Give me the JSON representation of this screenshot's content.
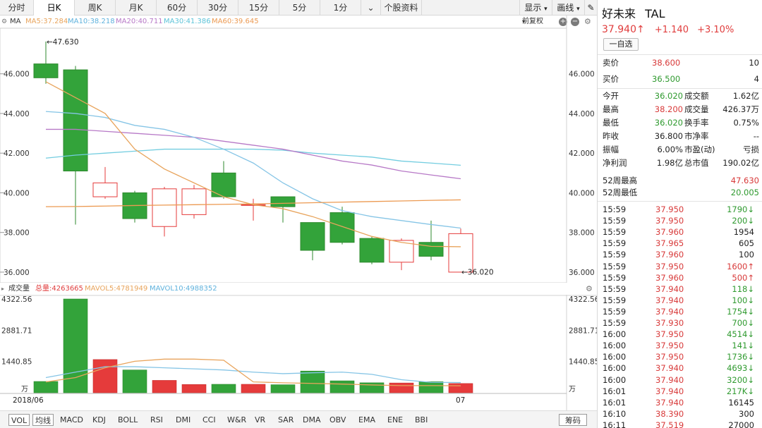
{
  "tabs": [
    {
      "label": "分时",
      "active": false
    },
    {
      "label": "日K",
      "active": true
    },
    {
      "label": "周K",
      "active": false
    },
    {
      "label": "月K",
      "active": false
    },
    {
      "label": "60分",
      "active": false
    },
    {
      "label": "30分",
      "active": false
    },
    {
      "label": "15分",
      "active": false
    },
    {
      "label": "5分",
      "active": false
    },
    {
      "label": "1分",
      "active": false
    }
  ],
  "tab_more": "⌄",
  "tab_info": "个股资料",
  "toolbar": {
    "display": "显示",
    "draw": "画线"
  },
  "ma_legend": {
    "ma": "MA",
    "ma5": "MA5:37.284",
    "ma10": "MA10:38.218",
    "ma20": "MA20:40.711",
    "ma30": "MA30:41.386",
    "ma60": "MA60:39.645",
    "adjust": "前复权"
  },
  "vol_legend": {
    "title": "成交量",
    "total": "总量:4263665",
    "mavol5": "MAVOL5:4781949",
    "mavol10": "MAVOL10:4988352"
  },
  "colors": {
    "up": "#e53b3b",
    "down": "#33a33a",
    "ma5": "#e8a45c",
    "ma10": "#86c5e6",
    "ma20": "#b779c7",
    "ma30": "#73cde0",
    "ma60": "#ec9a52"
  },
  "chart_data": {
    "type": "candlestick",
    "price_axis": {
      "ylim": [
        35.5,
        48.3
      ],
      "ticks": [
        "46.000",
        "44.000",
        "42.000",
        "40.000",
        "38.000",
        "36.000"
      ]
    },
    "max_label": "47.630",
    "min_label": "36.020",
    "candles": [
      {
        "open": 46.5,
        "close": 45.8,
        "high": 47.63,
        "low": 45.5
      },
      {
        "open": 46.2,
        "close": 41.1,
        "high": 46.4,
        "low": 38.4
      },
      {
        "open": 39.8,
        "close": 40.5,
        "high": 41.3,
        "low": 39.7
      },
      {
        "open": 40.0,
        "close": 38.7,
        "high": 40.1,
        "low": 38.5
      },
      {
        "open": 38.3,
        "close": 40.2,
        "high": 40.3,
        "low": 37.8
      },
      {
        "open": 38.9,
        "close": 40.2,
        "high": 40.4,
        "low": 38.7
      },
      {
        "open": 41.0,
        "close": 39.8,
        "high": 41.6,
        "low": 39.7
      },
      {
        "open": 39.4,
        "close": 39.4,
        "high": 39.7,
        "low": 38.6
      },
      {
        "open": 39.8,
        "close": 39.3,
        "high": 39.8,
        "low": 38.5
      },
      {
        "open": 38.5,
        "close": 37.1,
        "high": 38.5,
        "low": 36.6
      },
      {
        "open": 39.0,
        "close": 37.5,
        "high": 39.3,
        "low": 37.4
      },
      {
        "open": 37.7,
        "close": 36.5,
        "high": 37.8,
        "low": 36.4
      },
      {
        "open": 36.5,
        "close": 37.6,
        "high": 37.7,
        "low": 36.1
      },
      {
        "open": 37.5,
        "close": 36.8,
        "high": 38.6,
        "low": 36.6
      },
      {
        "open": 36.0,
        "close": 37.94,
        "high": 38.2,
        "low": 36.02
      }
    ],
    "ma_lines": {
      "ma5": [
        45.6,
        44.8,
        44.0,
        42.2,
        41.2,
        40.5,
        39.8,
        39.4,
        39.2,
        38.8,
        38.3,
        37.8,
        37.5,
        37.3,
        37.28
      ],
      "ma10": [
        44.1,
        44.0,
        43.8,
        43.4,
        43.2,
        42.8,
        42.2,
        41.5,
        40.5,
        39.7,
        39.1,
        38.8,
        38.6,
        38.4,
        38.22
      ],
      "ma20": [
        43.2,
        43.2,
        43.1,
        43.0,
        42.9,
        42.8,
        42.6,
        42.4,
        42.2,
        41.9,
        41.6,
        41.4,
        41.1,
        40.9,
        40.71
      ],
      "ma30": [
        41.75,
        41.9,
        42.0,
        42.1,
        42.2,
        42.2,
        42.2,
        42.2,
        42.15,
        42.0,
        41.9,
        41.8,
        41.6,
        41.5,
        41.39
      ],
      "ma60": [
        39.3,
        39.31,
        39.33,
        39.36,
        39.38,
        39.4,
        39.42,
        39.44,
        39.47,
        39.5,
        39.53,
        39.56,
        39.59,
        39.62,
        39.645
      ]
    },
    "volume_axis": {
      "ylim": [
        0,
        4322.56
      ],
      "ticks": [
        "4322.56",
        "2881.71",
        "1440.85"
      ],
      "unit": "万"
    },
    "volumes": [
      520,
      4322.56,
      1530,
      1050,
      570,
      380,
      390,
      390,
      370,
      1000,
      550,
      460,
      450,
      510,
      426
    ],
    "mavol5": [
      500,
      700,
      1150,
      1450,
      1550,
      1550,
      1500,
      500,
      460,
      430,
      400,
      360,
      330,
      330,
      320
    ],
    "mavol10": [
      700,
      950,
      1200,
      1200,
      1150,
      1100,
      1050,
      950,
      880,
      920,
      950,
      850,
      600,
      480,
      470
    ],
    "x_labels": [
      "2018/06",
      "07"
    ]
  },
  "indicators": [
    {
      "label": "VOL",
      "boxed": true
    },
    {
      "label": "均线",
      "boxed": true
    },
    {
      "label": "MACD",
      "boxed": false
    },
    {
      "label": "KDJ",
      "boxed": false
    },
    {
      "label": "BOLL",
      "boxed": false
    },
    {
      "label": "RSI",
      "boxed": false
    },
    {
      "label": "DMI",
      "boxed": false
    },
    {
      "label": "CCI",
      "boxed": false
    },
    {
      "label": "W&R",
      "boxed": false
    },
    {
      "label": "VR",
      "boxed": false
    },
    {
      "label": "SAR",
      "boxed": false
    },
    {
      "label": "DMA",
      "boxed": false
    },
    {
      "label": "OBV",
      "boxed": false
    },
    {
      "label": "EMA",
      "boxed": false
    },
    {
      "label": "ENE",
      "boxed": false
    },
    {
      "label": "BBI",
      "boxed": false
    }
  ],
  "chips_label": "筹码",
  "stock": {
    "name": "好未来",
    "ticker": "TAL",
    "price": "37.940↑",
    "change": "+1.140",
    "pct": "+3.10%",
    "add_watchlist": "一自选",
    "ask_label": "卖价",
    "ask_price": "38.600",
    "ask_size": "10",
    "bid_label": "买价",
    "bid_price": "36.500",
    "bid_size": "4",
    "stats": [
      {
        "l1": "今开",
        "v1": "36.020",
        "c1": "green",
        "l2": "成交额",
        "v2": "1.62亿"
      },
      {
        "l1": "最高",
        "v1": "38.200",
        "c1": "red",
        "l2": "成交量",
        "v2": "426.37万"
      },
      {
        "l1": "最低",
        "v1": "36.020",
        "c1": "green",
        "l2": "换手率",
        "v2": "0.75%"
      },
      {
        "l1": "昨收",
        "v1": "36.800",
        "c1": "plain",
        "l2": "市净率",
        "v2": "--"
      },
      {
        "l1": "振幅",
        "v1": "6.00%",
        "c1": "plain",
        "l2": "市盈(动)",
        "v2": "亏损"
      },
      {
        "l1": "净利润",
        "v1": "1.98亿",
        "c1": "plain",
        "l2": "总市值",
        "v2": "190.02亿"
      }
    ],
    "week52_high_label": "52周最高",
    "week52_high": "47.630",
    "week52_low_label": "52周最低",
    "week52_low": "20.005"
  },
  "ticks": [
    {
      "time": "15:59",
      "price": "37.950",
      "pc": "red",
      "vol": "1790↓",
      "vc": "green"
    },
    {
      "time": "15:59",
      "price": "37.950",
      "pc": "red",
      "vol": "200↓",
      "vc": "green"
    },
    {
      "time": "15:59",
      "price": "37.960",
      "pc": "red",
      "vol": "1954",
      "vc": "plain"
    },
    {
      "time": "15:59",
      "price": "37.965",
      "pc": "red",
      "vol": "605",
      "vc": "plain"
    },
    {
      "time": "15:59",
      "price": "37.960",
      "pc": "red",
      "vol": "100",
      "vc": "plain"
    },
    {
      "time": "15:59",
      "price": "37.950",
      "pc": "red",
      "vol": "1600↑",
      "vc": "red"
    },
    {
      "time": "15:59",
      "price": "37.960",
      "pc": "red",
      "vol": "500↑",
      "vc": "red"
    },
    {
      "time": "15:59",
      "price": "37.940",
      "pc": "red",
      "vol": "118↓",
      "vc": "green"
    },
    {
      "time": "15:59",
      "price": "37.940",
      "pc": "red",
      "vol": "100↓",
      "vc": "green"
    },
    {
      "time": "15:59",
      "price": "37.940",
      "pc": "red",
      "vol": "1754↓",
      "vc": "green"
    },
    {
      "time": "15:59",
      "price": "37.930",
      "pc": "red",
      "vol": "700↓",
      "vc": "green"
    },
    {
      "time": "16:00",
      "price": "37.950",
      "pc": "red",
      "vol": "4514↓",
      "vc": "green"
    },
    {
      "time": "16:00",
      "price": "37.950",
      "pc": "red",
      "vol": "141↓",
      "vc": "green"
    },
    {
      "time": "16:00",
      "price": "37.950",
      "pc": "red",
      "vol": "1736↓",
      "vc": "green"
    },
    {
      "time": "16:00",
      "price": "37.940",
      "pc": "red",
      "vol": "4693↓",
      "vc": "green"
    },
    {
      "time": "16:00",
      "price": "37.940",
      "pc": "red",
      "vol": "3200↓",
      "vc": "green"
    },
    {
      "time": "16:01",
      "price": "37.940",
      "pc": "red",
      "vol": "217K↓",
      "vc": "green"
    },
    {
      "time": "16:01",
      "price": "37.940",
      "pc": "red",
      "vol": "16145",
      "vc": "plain"
    },
    {
      "time": "16:10",
      "price": "38.390",
      "pc": "red",
      "vol": "300",
      "vc": "plain"
    },
    {
      "time": "16:11",
      "price": "37.519",
      "pc": "red",
      "vol": "27000",
      "vc": "plain"
    }
  ]
}
